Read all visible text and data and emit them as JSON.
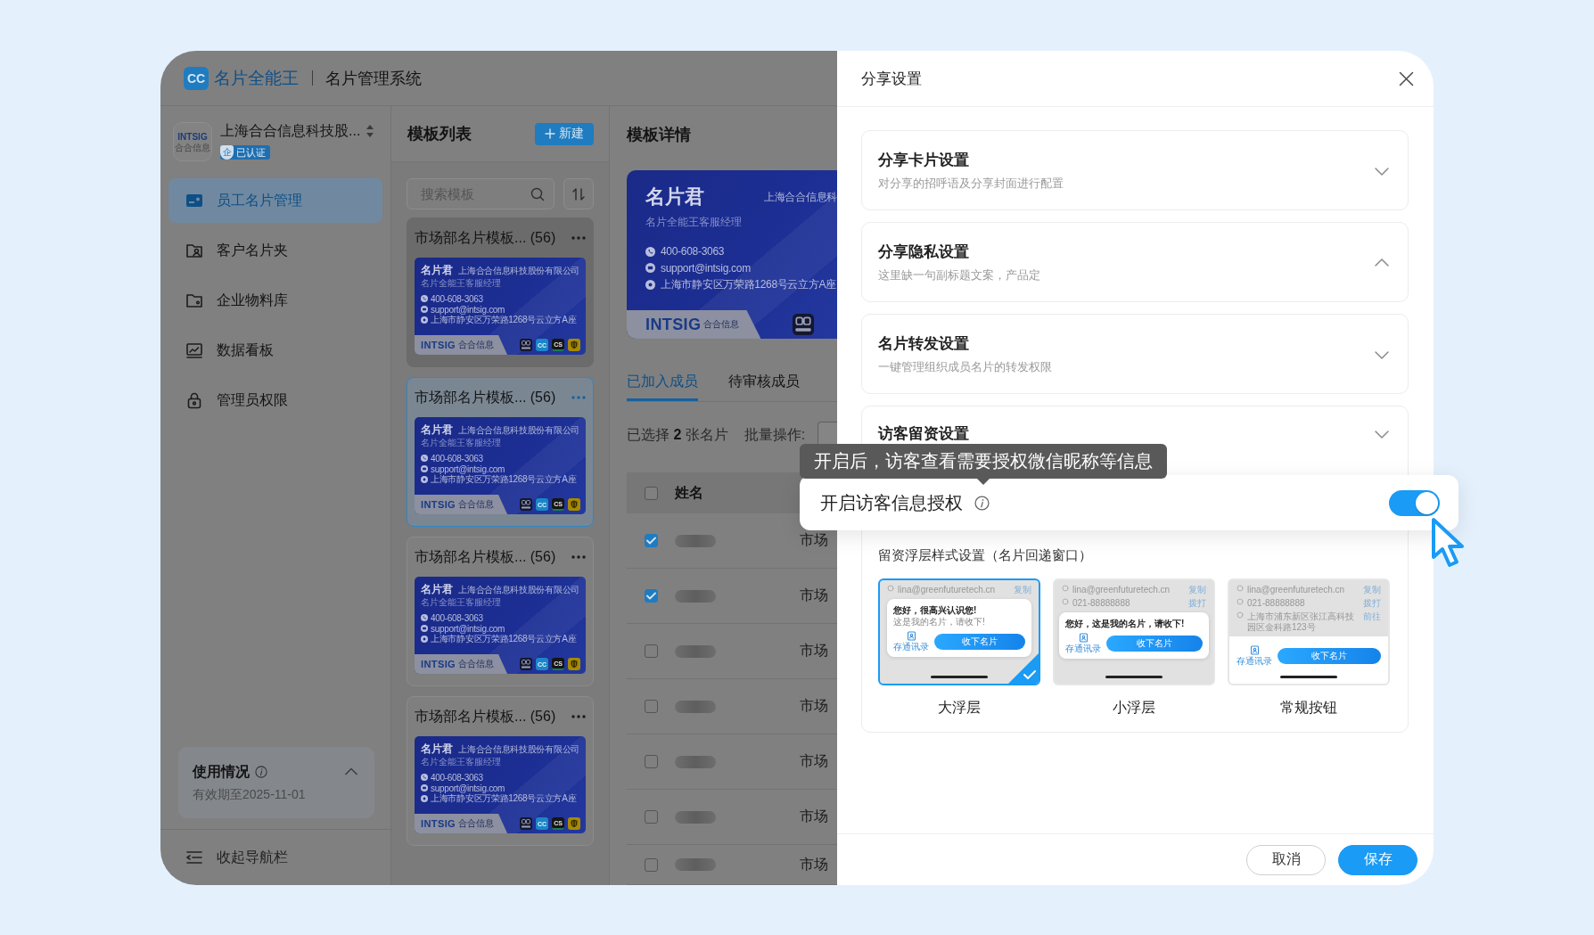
{
  "header": {
    "logo_mark": "CC",
    "brand": "名片全能王",
    "system": "名片管理系统"
  },
  "sidebar": {
    "company": {
      "logo": "INTSIG",
      "logo_cn": "合合信息",
      "name": "上海合合信息科技股...",
      "badge_mark": "企",
      "badge": "已认证"
    },
    "items": [
      {
        "kind": "card",
        "label": "员工名片管理",
        "selected": true
      },
      {
        "kind": "contacts",
        "label": "客户名片夹",
        "selected": false
      },
      {
        "kind": "folder",
        "label": "企业物料库",
        "selected": false
      },
      {
        "kind": "chart",
        "label": "数据看板",
        "selected": false
      },
      {
        "kind": "lock",
        "label": "管理员权限",
        "selected": false
      }
    ],
    "usage": {
      "title": "使用情况",
      "expires": "有效期至2025-11-01",
      "expanded": true
    },
    "collapse_label": "收起导航栏"
  },
  "template_list": {
    "title": "模板列表",
    "new_button": "新建",
    "search": {
      "placeholder": "搜索模板"
    },
    "cards": [
      {
        "title": "市场部名片模板... (56)",
        "selected": false,
        "hovered": true,
        "preview": {
          "name": "名片君",
          "company": "上海合合信息科技股份有限公司",
          "title": "名片全能王客服经理",
          "phone": "400-608-3063",
          "email": "support@intsig.com",
          "address": "上海市静安区万荣路1268号云立方A座",
          "brand": "INTSIG",
          "brand_cn": "合合信息",
          "apps": [
            {
              "kind": "hehe"
            },
            {
              "kind": "cc",
              "label": "CC"
            },
            {
              "kind": "cs",
              "label": "CS"
            },
            {
              "kind": "shield"
            }
          ]
        }
      },
      {
        "title": "市场部名片模板... (56)",
        "selected": true,
        "hovered": false,
        "preview": {
          "name": "名片君",
          "company": "上海合合信息科技股份有限公司",
          "title": "名片全能王客服经理",
          "phone": "400-608-3063",
          "email": "support@intsig.com",
          "address": "上海市静安区万荣路1268号云立方A座",
          "brand": "INTSIG",
          "brand_cn": "合合信息",
          "apps": [
            {
              "kind": "hehe"
            },
            {
              "kind": "cc",
              "label": "CC"
            },
            {
              "kind": "cs",
              "label": "CS"
            },
            {
              "kind": "shield"
            }
          ]
        }
      },
      {
        "title": "市场部名片模板... (56)",
        "selected": false,
        "hovered": false,
        "preview": {
          "name": "名片君",
          "company": "上海合合信息科技股份有限公司",
          "title": "名片全能王客服经理",
          "phone": "400-608-3063",
          "email": "support@intsig.com",
          "address": "上海市静安区万荣路1268号云立方A座",
          "brand": "INTSIG",
          "brand_cn": "合合信息",
          "apps": [
            {
              "kind": "hehe"
            },
            {
              "kind": "cc",
              "label": "CC"
            },
            {
              "kind": "cs",
              "label": "CS"
            },
            {
              "kind": "shield"
            }
          ]
        }
      },
      {
        "title": "市场部名片模板... (56)",
        "selected": false,
        "hovered": false,
        "preview": {
          "name": "名片君",
          "company": "上海合合信息科技股份有限公司",
          "title": "名片全能王客服经理",
          "phone": "400-608-3063",
          "email": "support@intsig.com",
          "address": "上海市静安区万荣路1268号云立方A座",
          "brand": "INTSIG",
          "brand_cn": "合合信息",
          "apps": [
            {
              "kind": "hehe"
            },
            {
              "kind": "cc",
              "label": "CC"
            },
            {
              "kind": "cs",
              "label": "CS"
            },
            {
              "kind": "shield"
            }
          ]
        }
      }
    ]
  },
  "template_detail": {
    "title": "模板详情",
    "preview": {
      "name": "名片君",
      "company": "上海合合信息科",
      "title": "名片全能王客服经理",
      "phone": "400-608-3063",
      "email": "support@intsig.com",
      "address": "上海市静安区万荣路1268号云立方A座",
      "brand": "INTSIG",
      "brand_cn": "合合信息",
      "apps": [
        {
          "kind": "hehe"
        }
      ]
    },
    "tabs": [
      {
        "label": "已加入成员",
        "selected": true
      },
      {
        "label": "待审核成员",
        "selected": false
      }
    ],
    "selection": "已选择 **2** 张名片",
    "batch_label": "批量操作:",
    "table": {
      "header_checked": false,
      "columns": [
        "姓名"
      ],
      "rows": [
        {
          "checked": true,
          "column_3": "市场"
        },
        {
          "checked": true,
          "column_3": "市场"
        },
        {
          "checked": false,
          "column_3": "市场"
        },
        {
          "checked": false,
          "column_3": "市场"
        },
        {
          "checked": false,
          "column_3": "市场"
        },
        {
          "checked": false,
          "column_3": "市场"
        },
        {
          "checked": false,
          "column_3": "市场"
        }
      ]
    }
  },
  "drawer": {
    "title": "分享设置",
    "sections": [
      {
        "title": "分享卡片设置",
        "subtitle": "对分享的招呼语及分享封面进行配置",
        "expanded": false
      },
      {
        "title": "分享隐私设置",
        "subtitle": "这里缺一句副标题文案，产品定",
        "expanded": true
      },
      {
        "title": "名片转发设置",
        "subtitle": "一键管理组织成员名片的转发权限",
        "expanded": false
      },
      {
        "title": "访客留资设置",
        "expanded": false,
        "toggle": {
          "label": "开启访客信息授权",
          "on": true,
          "tooltip": "开启后，访客查看需要授权微信昵称等信息"
        },
        "styles": {
          "title": "留资浮层样式设置（名片回递窗口）",
          "options": [
            {
              "kind": "large",
              "label": "大浮层",
              "selected": true,
              "rows": [
                {
                  "text": "lina@greenfuturetech.cn",
                  "action": "复制"
                }
              ],
              "greeting": "您好，很高兴认识您!",
              "message": "这是我的名片，请收下!",
              "save_label": "存通讯录",
              "button": "收下名片"
            },
            {
              "kind": "small",
              "label": "小浮层",
              "selected": false,
              "rows": [
                {
                  "text": "lina@greenfuturetech.cn",
                  "action": "复制"
                },
                {
                  "text": "021-88888888",
                  "action": "拨打"
                }
              ],
              "greeting": "您好，这是我的名片，请收下!",
              "save_label": "存通讯录",
              "button": "收下名片"
            },
            {
              "kind": "regular",
              "label": "常规按钮",
              "selected": false,
              "rows": [
                {
                  "text": "lina@greenfuturetech.cn",
                  "action": "复制"
                },
                {
                  "text": "021-88888888",
                  "action": "拨打"
                },
                {
                  "text": "上海市浦东新区张江高科技园区金科路123号",
                  "action": "前往"
                }
              ],
              "save_label": "存通讯录",
              "button": "收下名片"
            }
          ]
        }
      }
    ],
    "buttons": [
      {
        "kind": "cancel",
        "label": "取消"
      },
      {
        "kind": "save",
        "label": "保存"
      }
    ]
  }
}
